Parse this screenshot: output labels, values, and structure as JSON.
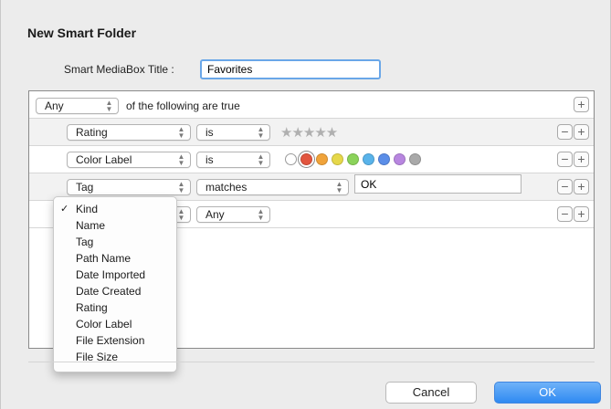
{
  "dialog": {
    "title": "New Smart Folder"
  },
  "mediabox": {
    "label": "Smart MediaBox Title :",
    "value": "Favorites"
  },
  "criteria": {
    "match_popup": "Any",
    "match_suffix": "of the following are true",
    "rows": [
      {
        "field": "Rating",
        "op": "is",
        "stars": "★★★★★"
      },
      {
        "field": "Color Label",
        "op": "is"
      },
      {
        "field": "Tag",
        "op": "matches",
        "value": "OK"
      },
      {
        "field": "Kind",
        "op": "Any"
      }
    ],
    "color_swatches": [
      "none",
      "#e2553f",
      "#f0a33a",
      "#e6d84a",
      "#8bd35a",
      "#59b3ea",
      "#5b8ee8",
      "#b886e0",
      "#a9a9a9"
    ]
  },
  "field_menu": {
    "checked": "Kind",
    "items": [
      "Kind",
      "Name",
      "Tag",
      "Path Name",
      "Date Imported",
      "Date Created",
      "Rating",
      "Color Label",
      "File Extension",
      "File Size"
    ]
  },
  "buttons": {
    "cancel": "Cancel",
    "ok": "OK"
  },
  "icons": {
    "add": "plus-icon",
    "remove": "minus-icon",
    "popup": "updown-chevron-icon",
    "check": "checkmark-icon"
  }
}
